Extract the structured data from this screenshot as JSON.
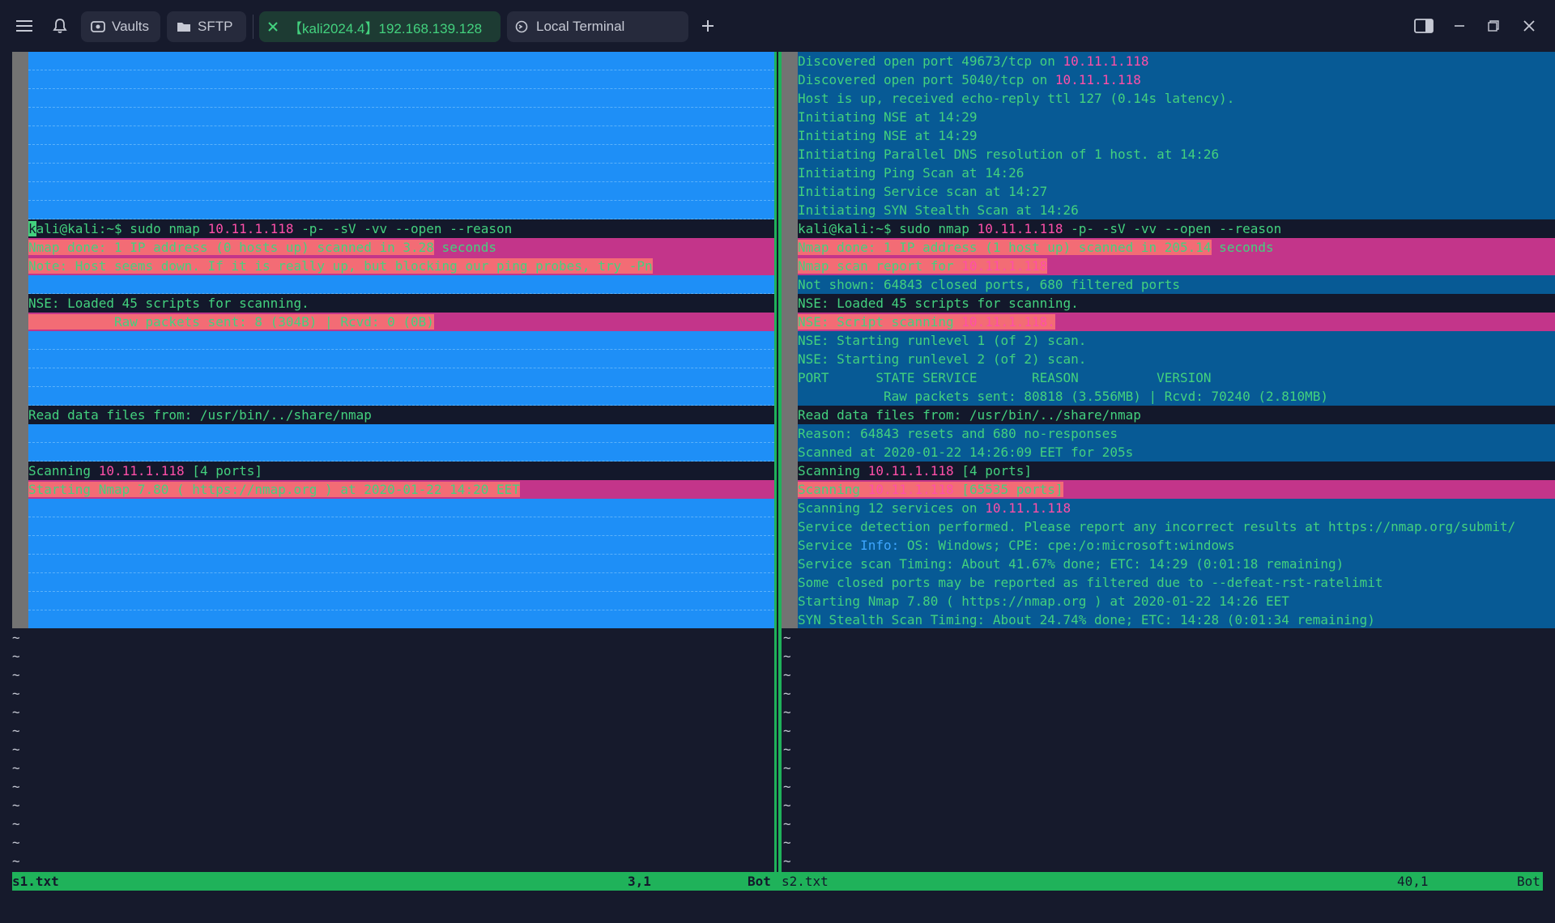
{
  "titlebar": {
    "vaults_label": "Vaults",
    "sftp_label": "SFTP",
    "active_tab_label": "【kali2024.4】192.168.139.128",
    "local_tab_label": "Local Terminal",
    "icons": {
      "menu": "hamburger-menu-icon",
      "bell": "bell-icon",
      "vaults": "vault-icon",
      "sftp": "folder-icon",
      "close_tab": "close-icon",
      "local_terminal": "terminal-icon",
      "add_tab": "plus-icon",
      "side_panel": "side-panel-icon",
      "minimize": "minimize-icon",
      "restore": "restore-icon",
      "close_window": "close-icon"
    }
  },
  "left_pane": {
    "lines": [
      {
        "type": "fill"
      },
      {
        "type": "fill"
      },
      {
        "type": "fill"
      },
      {
        "type": "fill"
      },
      {
        "type": "fill"
      },
      {
        "type": "fill"
      },
      {
        "type": "fill"
      },
      {
        "type": "fill"
      },
      {
        "type": "fill"
      },
      {
        "type": "dark",
        "parts": [
          {
            "t": "k",
            "c": "cursor"
          },
          {
            "t": "ali@kali:~$ sudo nmap ",
            "c": "txt"
          },
          {
            "t": "10.11.1.118",
            "c": "ip"
          },
          {
            "t": " -p- -sV -vv --open --reason",
            "c": "txt"
          }
        ]
      },
      {
        "type": "pink",
        "parts": [
          {
            "t": "Nmap done: 1 IP address (",
            "c": "hl-salmon"
          },
          {
            "t": "0 hosts up) scanned in 3.28",
            "c": "hl-salmon"
          },
          {
            "t": " seconds",
            "c": "txt"
          }
        ]
      },
      {
        "type": "pink",
        "parts": [
          {
            "t": "Note: Host seems down. If it is really up, but blocking our ping probes, try -Pn",
            "c": "hl-salmon"
          }
        ]
      },
      {
        "type": "fill"
      },
      {
        "type": "dark",
        "parts": [
          {
            "t": "NSE: Loaded 45 scripts for scanning.",
            "c": "txt"
          }
        ]
      },
      {
        "type": "pink",
        "parts": [
          {
            "t": "           Raw packets sent: 8 (304B) | Rcvd: 0 (0B)",
            "c": "hl-salmon"
          }
        ]
      },
      {
        "type": "fill"
      },
      {
        "type": "fill"
      },
      {
        "type": "fill"
      },
      {
        "type": "fill"
      },
      {
        "type": "dark",
        "parts": [
          {
            "t": "Read data files from: /usr/bin/../share/nmap",
            "c": "txt"
          }
        ]
      },
      {
        "type": "fill"
      },
      {
        "type": "fill"
      },
      {
        "type": "dark",
        "parts": [
          {
            "t": "Scanning ",
            "c": "txt"
          },
          {
            "t": "10.11.1.118",
            "c": "ip"
          },
          {
            "t": " [4 ports]",
            "c": "txt"
          }
        ]
      },
      {
        "type": "pink",
        "parts": [
          {
            "t": "Starting Nmap 7.80 ( https://nmap.org ) at 2020-01-22 14:20 EET",
            "c": "hl-salmon"
          }
        ]
      },
      {
        "type": "fill"
      },
      {
        "type": "fill"
      },
      {
        "type": "fill"
      },
      {
        "type": "fill"
      },
      {
        "type": "fill"
      },
      {
        "type": "fill"
      },
      {
        "type": "fill"
      }
    ]
  },
  "right_pane": {
    "lines": [
      {
        "type": "cyan",
        "parts": [
          {
            "t": "Discovered open port 49673/tcp on ",
            "c": "txt"
          },
          {
            "t": "10.11.1.118",
            "c": "ip"
          }
        ]
      },
      {
        "type": "cyan",
        "parts": [
          {
            "t": "Discovered open port 5040/tcp on ",
            "c": "txt"
          },
          {
            "t": "10.11.1.118",
            "c": "ip"
          }
        ]
      },
      {
        "type": "cyan",
        "parts": [
          {
            "t": "Host is up, received echo-reply ttl 127 (0.14s latency).",
            "c": "txt"
          }
        ]
      },
      {
        "type": "cyan",
        "parts": [
          {
            "t": "Initiating NSE at 14:29",
            "c": "txt"
          }
        ]
      },
      {
        "type": "cyan",
        "parts": [
          {
            "t": "Initiating NSE at 14:29",
            "c": "txt"
          }
        ]
      },
      {
        "type": "cyan",
        "parts": [
          {
            "t": "Initiating Parallel DNS resolution of 1 host. at 14:26",
            "c": "txt"
          }
        ]
      },
      {
        "type": "cyan",
        "parts": [
          {
            "t": "Initiating Ping Scan at 14:26",
            "c": "txt"
          }
        ]
      },
      {
        "type": "cyan",
        "parts": [
          {
            "t": "Initiating Service scan at 14:27",
            "c": "txt"
          }
        ]
      },
      {
        "type": "cyan",
        "parts": [
          {
            "t": "Initiating SYN Stealth Scan at 14:26",
            "c": "txt"
          }
        ]
      },
      {
        "type": "dark",
        "parts": [
          {
            "t": "kali@kali:~$ sudo nmap ",
            "c": "txt"
          },
          {
            "t": "10.11.1.118",
            "c": "ip"
          },
          {
            "t": " -p- -sV -vv --open --reason",
            "c": "txt"
          }
        ]
      },
      {
        "type": "pink",
        "parts": [
          {
            "t": "Nmap done: 1 IP address (",
            "c": "hl-salmon"
          },
          {
            "t": "1 host up) scanned in 205.14",
            "c": "hl-salmon"
          },
          {
            "t": " seconds",
            "c": "txt"
          }
        ]
      },
      {
        "type": "pink",
        "parts": [
          {
            "t": "Nmap scan report for ",
            "c": "hl-salmon"
          },
          {
            "t": "10.11.1.118",
            "c": "hl-pink-ip"
          }
        ]
      },
      {
        "type": "cyan",
        "parts": [
          {
            "t": "Not shown: 64843 closed ports, 680 filtered ports",
            "c": "txt"
          }
        ]
      },
      {
        "type": "dark",
        "parts": [
          {
            "t": "NSE: Loaded 45 scripts for scanning.",
            "c": "txt"
          }
        ]
      },
      {
        "type": "pink",
        "parts": [
          {
            "t": "NSE: Script scanning ",
            "c": "hl-salmon"
          },
          {
            "t": "10.11.1.118.",
            "c": "hl-pink-ip"
          }
        ]
      },
      {
        "type": "cyan",
        "parts": [
          {
            "t": "NSE: Starting runlevel 1 (of 2) scan.",
            "c": "txt"
          }
        ]
      },
      {
        "type": "cyan",
        "parts": [
          {
            "t": "NSE: Starting runlevel 2 (of 2) scan.",
            "c": "txt"
          }
        ]
      },
      {
        "type": "cyan",
        "parts": [
          {
            "t": "PORT      STATE SERVICE       REASON          VERSION",
            "c": "txt"
          }
        ]
      },
      {
        "type": "cyan",
        "parts": [
          {
            "t": "           Raw packets sent: 80818 (3.556MB) | Rcvd: 70240 (2.810MB)",
            "c": "txt"
          }
        ]
      },
      {
        "type": "dark",
        "parts": [
          {
            "t": "Read data files from: /usr/bin/../share/nmap",
            "c": "txt"
          }
        ]
      },
      {
        "type": "cyan",
        "parts": [
          {
            "t": "Reason: 64843 resets and 680 no-responses",
            "c": "txt"
          }
        ]
      },
      {
        "type": "cyan",
        "parts": [
          {
            "t": "Scanned at 2020-01-22 14:26:09 EET for 205s",
            "c": "txt"
          }
        ]
      },
      {
        "type": "dark",
        "parts": [
          {
            "t": "Scanning ",
            "c": "txt"
          },
          {
            "t": "10.11.1.118",
            "c": "ip"
          },
          {
            "t": " [4 ports]",
            "c": "txt"
          }
        ]
      },
      {
        "type": "pink",
        "parts": [
          {
            "t": "Scanning ",
            "c": "hl-salmon"
          },
          {
            "t": "10.11.1.118",
            "c": "hl-pink-ip"
          },
          {
            "t": " [65535 ports]",
            "c": "hl-salmon"
          }
        ]
      },
      {
        "type": "cyan",
        "parts": [
          {
            "t": "Scanning 12 services on ",
            "c": "txt"
          },
          {
            "t": "10.11.1.118",
            "c": "ip"
          }
        ]
      },
      {
        "type": "cyan",
        "parts": [
          {
            "t": "Service detection performed. Please report any incorrect results at https://nmap.org/submit/",
            "c": "txt"
          }
        ]
      },
      {
        "type": "cyan",
        "parts": [
          {
            "t": "Service ",
            "c": "txt"
          },
          {
            "t": "Info:",
            "c": "info-blue"
          },
          {
            "t": " OS: Windows; CPE: cpe:/o:microsoft:windows",
            "c": "txt"
          }
        ]
      },
      {
        "type": "cyan",
        "parts": [
          {
            "t": "Service scan Timing: About 41.67% done; ETC: 14:29 (0:01:18 remaining)",
            "c": "txt"
          }
        ]
      },
      {
        "type": "cyan",
        "parts": [
          {
            "t": "Some closed ports may be reported as filtered due to --defeat-rst-ratelimit",
            "c": "txt"
          }
        ]
      },
      {
        "type": "cyan",
        "parts": [
          {
            "t": "Starting Nmap 7.80 ( https://nmap.org ) at 2020-01-22 14:26 EET",
            "c": "txt"
          }
        ]
      },
      {
        "type": "cyan",
        "parts": [
          {
            "t": "SYN Stealth Scan Timing: About 24.74% done; ETC: 14:28 (0:01:34 remaining)",
            "c": "txt"
          }
        ]
      }
    ]
  },
  "tilde_char": "~",
  "tilde_count": 13,
  "statusbar": {
    "left_file": "s1.txt",
    "left_pos": "3,1",
    "left_scroll": "Bot",
    "right_file": "s2.txt",
    "right_pos": "40,1",
    "right_scroll": "Bot"
  },
  "colors": {
    "background": "#161a2c",
    "text_green": "#43d17e",
    "ip_pink": "#ff4fa8",
    "fill_blue": "#1e8ff7",
    "diff_pink": "#c3358a",
    "diff_salmon": "#f36c75",
    "diff_cyan": "#075a95",
    "status_green": "#1fb25a"
  }
}
